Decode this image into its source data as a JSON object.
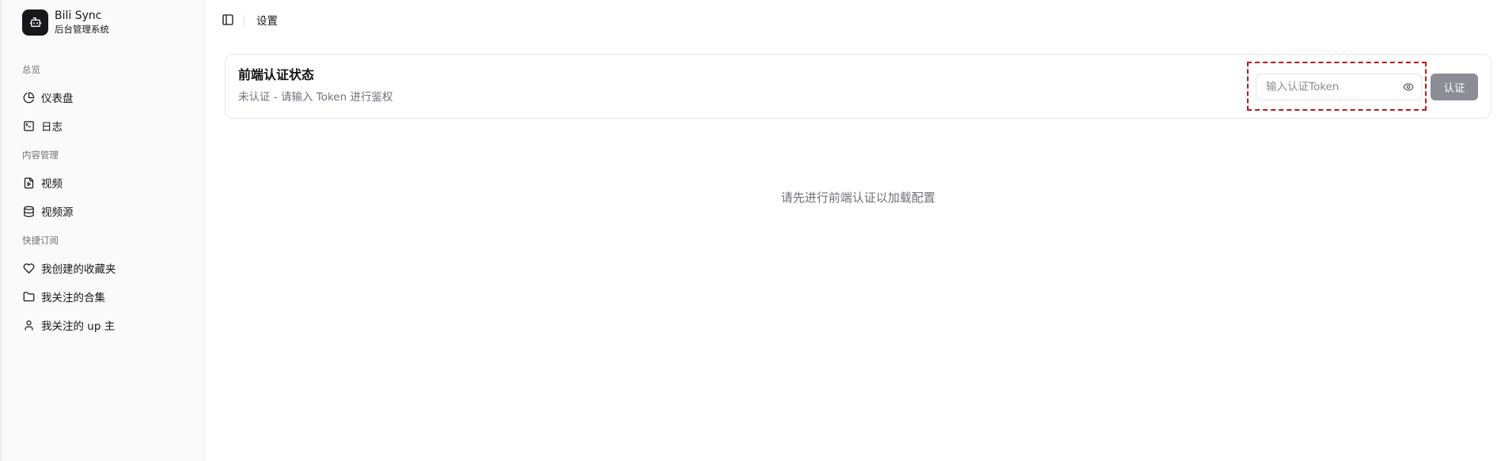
{
  "brand": {
    "name": "Bili Sync",
    "subtitle": "后台管理系统"
  },
  "sidebar": {
    "groups": [
      {
        "label": "总览",
        "items": [
          {
            "label": "仪表盘",
            "icon": "pie-chart-icon"
          },
          {
            "label": "日志",
            "icon": "terminal-icon"
          }
        ]
      },
      {
        "label": "内容管理",
        "items": [
          {
            "label": "视频",
            "icon": "video-file-icon"
          },
          {
            "label": "视频源",
            "icon": "database-icon"
          }
        ]
      },
      {
        "label": "快捷订阅",
        "items": [
          {
            "label": "我创建的收藏夹",
            "icon": "heart-icon"
          },
          {
            "label": "我关注的合集",
            "icon": "folder-icon"
          },
          {
            "label": "我关注的 up 主",
            "icon": "user-icon"
          }
        ]
      }
    ]
  },
  "header": {
    "breadcrumb": "设置",
    "toggle_icon": "sidebar-toggle-icon"
  },
  "auth": {
    "title": "前端认证状态",
    "status": "未认证 - 请输入 Token 进行鉴权",
    "token_placeholder": "输入认证Token",
    "token_value": "",
    "button_label": "认证"
  },
  "main": {
    "empty_message": "请先进行前端认证以加载配置"
  },
  "colors": {
    "sidebar_bg": "#fafafa",
    "button_disabled": "#8c8c96",
    "focus_outline": "#b91c1c",
    "muted_text": "#71717a"
  }
}
